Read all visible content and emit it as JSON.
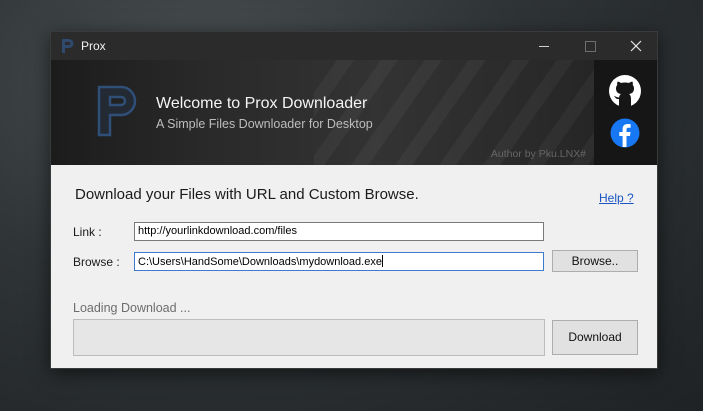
{
  "window": {
    "title": "Prox",
    "controls": [
      "minimize-icon",
      "maximize-icon",
      "close-icon"
    ]
  },
  "banner": {
    "logo_letter": "P",
    "welcome": "Welcome to Prox Downloader",
    "subtitle": "A Simple Files Downloader for Desktop",
    "author": "Author by Pku.LNX#",
    "icons": [
      "github-icon",
      "facebook-icon"
    ]
  },
  "main": {
    "heading": "Download your Files with URL and Custom Browse.",
    "help_link": "Help ?",
    "link_label": "Link :",
    "link_value": "http://yourlinkdownload.com/files",
    "browse_label": "Browse :",
    "browse_value": "C:\\Users\\HandSome\\Downloads\\mydownload.exe",
    "browse_button": "Browse..",
    "status": "Loading Download ...",
    "progress": 0,
    "download_button": "Download"
  },
  "colors": {
    "accent_link": "#1a55c0",
    "banner_bg": "#2a2a2a",
    "facebook_blue": "#1877f2"
  }
}
